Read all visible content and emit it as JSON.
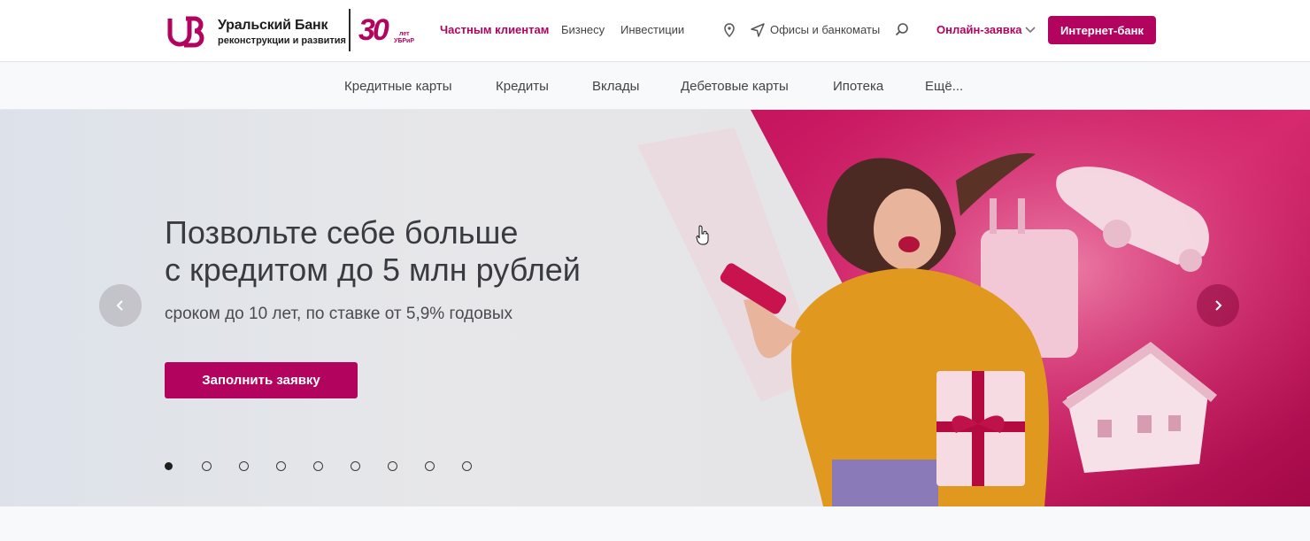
{
  "brand": {
    "name_line1": "Уральский Банк",
    "name_line2": "реконструкции и развития",
    "anniversary_number": "30",
    "anniversary_word": "лет",
    "anniversary_abbr": "УБРиР",
    "accent_color": "#b2045f"
  },
  "header": {
    "nav": [
      {
        "label": "Частным клиентам",
        "active": true
      },
      {
        "label": "Бизнесу",
        "active": false
      },
      {
        "label": "Инвестиции",
        "active": false
      }
    ],
    "location_icon": "map-pin-icon",
    "offices_icon": "navigation-arrow-icon",
    "offices_label": "Офисы и банкоматы",
    "search_icon": "search-icon",
    "online_request_label": "Онлайн-заявка",
    "online_request_icon": "chevron-down-icon",
    "internet_bank_label": "Интернет-банк"
  },
  "subnav": {
    "items": [
      "Кредитные карты",
      "Кредиты",
      "Вклады",
      "Дебетовые карты",
      "Ипотека",
      "Ещё..."
    ]
  },
  "hero": {
    "title_line1": "Позвольте себе больше",
    "title_line2": "с кредитом до 5 млн рублей",
    "subtitle": "сроком до 10 лет, по ставке от 5,9% годовых",
    "cta_label": "Заполнить заявку",
    "prev_icon": "chevron-left-icon",
    "next_icon": "chevron-right-icon",
    "slides_total": 9,
    "active_slide": 1
  }
}
